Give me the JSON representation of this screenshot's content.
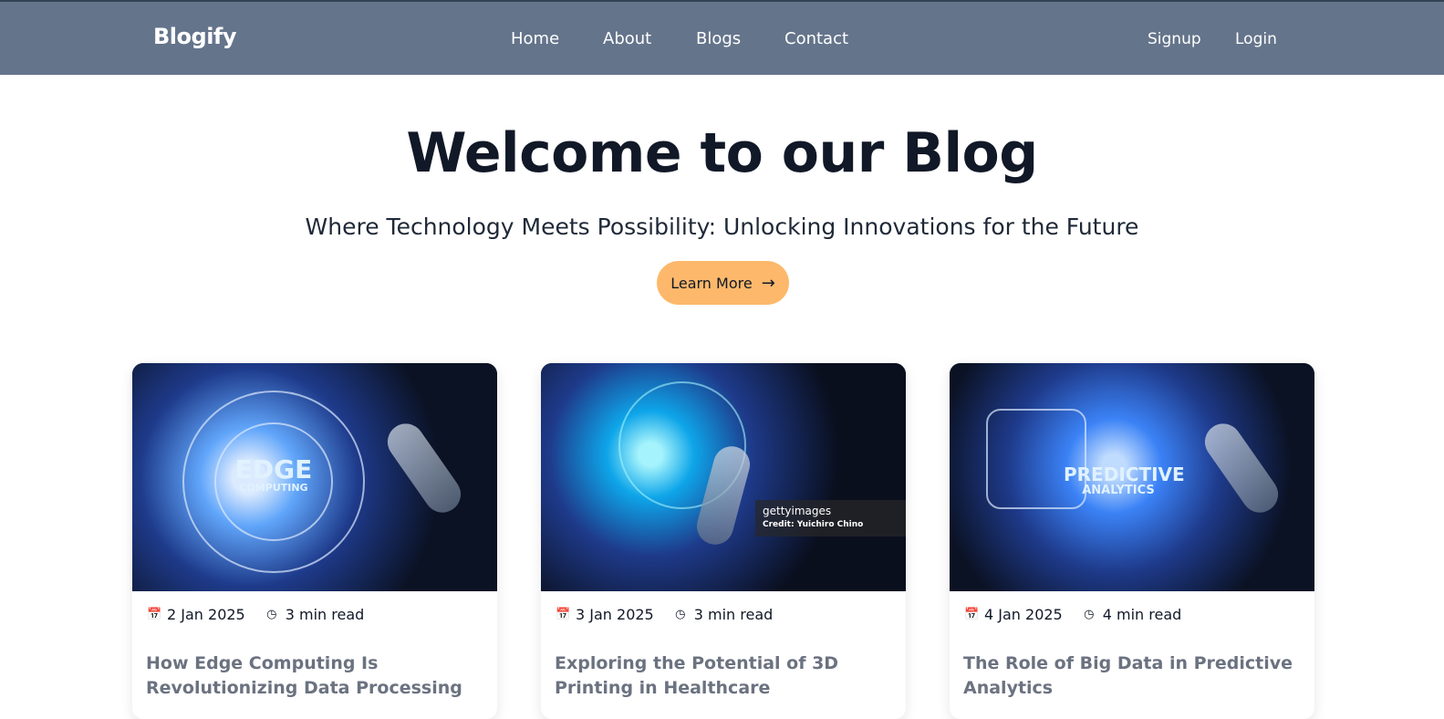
{
  "header": {
    "brand": "Blogify",
    "nav": [
      "Home",
      "About",
      "Blogs",
      "Contact"
    ],
    "auth": {
      "signup": "Signup",
      "login": "Login"
    }
  },
  "hero": {
    "title": "Welcome to our Blog",
    "subtitle": "Where Technology Meets Possibility: Unlocking Innovations for the Future",
    "cta_label": "Learn More"
  },
  "cards": [
    {
      "date": "2 Jan 2025",
      "read_time": "3 min read",
      "title": "How Edge Computing Is Revolutionizing Data Processing",
      "image_text_1": "EDGE",
      "image_text_2": "COMPUTING"
    },
    {
      "date": "3 Jan 2025",
      "read_time": "3 min read",
      "title": "Exploring the Potential of 3D Printing in Healthcare",
      "watermark": "gettyimages",
      "watermark_credit": "Credit: Yuichiro Chino"
    },
    {
      "date": "4 Jan 2025",
      "read_time": "4 min read",
      "title": "The Role of Big Data in Predictive Analytics",
      "image_text_1": "PREDICTIVE",
      "image_text_2": "ANALYTICS"
    }
  ],
  "icons": {
    "calendar": "calendar-icon",
    "clock": "clock-icon",
    "arrow": "arrow-right-icon"
  },
  "colors": {
    "header_bg": "#64748b",
    "cta_bg": "#fdb86b",
    "title_text": "#111827"
  }
}
